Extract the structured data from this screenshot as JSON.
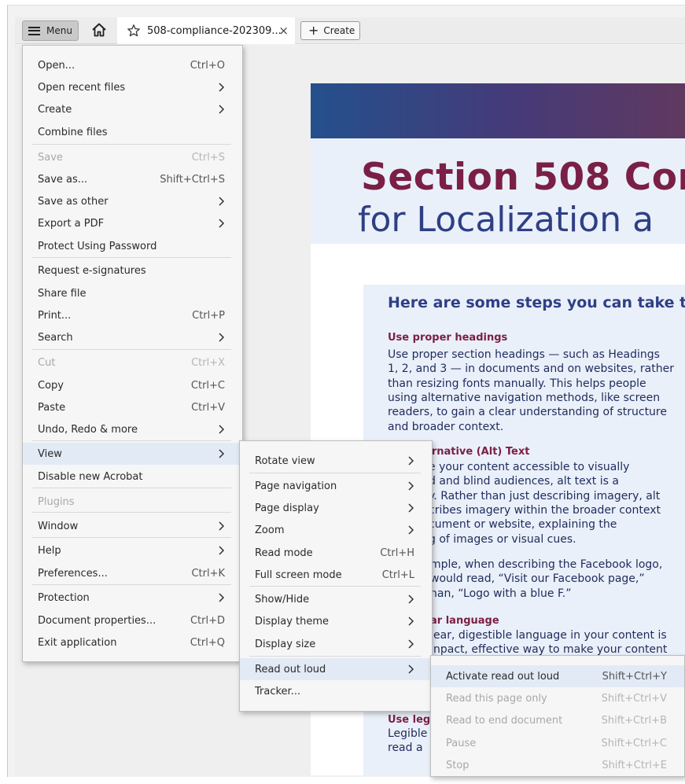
{
  "toolbar": {
    "menu_label": "Menu",
    "tab_title": "508-compliance-202309...",
    "tab_close": "×",
    "create_label": "Create"
  },
  "document": {
    "heading_line1": "Section 508 Cor",
    "heading_line2": "for Localization a",
    "box_title": "Here are some steps you can take t",
    "sections": [
      {
        "heading": "Use proper headings",
        "lines": [
          "Use proper section headings — such as Headings",
          "1, 2, and 3 — in documents and on websites, rather",
          "than resizing fonts manually. This helps people",
          "using alternative navigation methods, like screen",
          "readers, to gain a clear understanding of structure",
          "and broader context."
        ]
      },
      {
        "heading": "ernative (Alt) Text",
        "lines": [
          "e your content accessible to visually",
          "d and blind audiences, alt text is a",
          "y. Rather than just describing imagery, alt",
          "cribes imagery within the broader context",
          "cument or website, explaining the",
          "g of images or visual cues."
        ]
      },
      {
        "heading": "",
        "lines": [
          "mple, when describing the Facebook logo,",
          "would read, “Visit our Facebook page,”",
          "han, “Logo with a blue F.”"
        ]
      },
      {
        "heading": "ar language",
        "lines": [
          "ear, digestible language in your content is",
          "npact, effective way to make your content"
        ]
      },
      {
        "heading": "Use leg",
        "lines": [
          "Legible",
          "read a"
        ]
      }
    ]
  },
  "main_menu": [
    {
      "label": "Open...",
      "shortcut": "Ctrl+O"
    },
    {
      "label": "Open recent files",
      "submenu": true
    },
    {
      "label": "Create",
      "submenu": true
    },
    {
      "label": "Combine files"
    },
    {
      "label": "Save",
      "shortcut": "Ctrl+S",
      "disabled": true
    },
    {
      "label": "Save as...",
      "shortcut": "Shift+Ctrl+S"
    },
    {
      "label": "Save as other",
      "submenu": true
    },
    {
      "label": "Export a PDF",
      "submenu": true
    },
    {
      "label": "Protect Using Password"
    },
    {
      "label": "Request e-signatures"
    },
    {
      "label": "Share file"
    },
    {
      "label": "Print...",
      "shortcut": "Ctrl+P"
    },
    {
      "label": "Search",
      "submenu": true
    },
    {
      "label": "Cut",
      "shortcut": "Ctrl+X",
      "disabled": true
    },
    {
      "label": "Copy",
      "shortcut": "Ctrl+C"
    },
    {
      "label": "Paste",
      "shortcut": "Ctrl+V"
    },
    {
      "label": "Undo, Redo & more",
      "submenu": true
    },
    {
      "label": "View",
      "submenu": true,
      "highlighted": true
    },
    {
      "label": "Disable new Acrobat"
    },
    {
      "label": "Plugins",
      "disabled": true
    },
    {
      "label": "Window",
      "submenu": true
    },
    {
      "label": "Help",
      "submenu": true
    },
    {
      "label": "Preferences...",
      "shortcut": "Ctrl+K"
    },
    {
      "label": "Protection",
      "submenu": true
    },
    {
      "label": "Document properties...",
      "shortcut": "Ctrl+D"
    },
    {
      "label": "Exit application",
      "shortcut": "Ctrl+Q"
    }
  ],
  "view_menu": [
    {
      "label": "Rotate view",
      "submenu": true
    },
    {
      "label": "Page navigation",
      "submenu": true
    },
    {
      "label": "Page display",
      "submenu": true
    },
    {
      "label": "Zoom",
      "submenu": true
    },
    {
      "label": "Read mode",
      "shortcut": "Ctrl+H"
    },
    {
      "label": "Full screen mode",
      "shortcut": "Ctrl+L"
    },
    {
      "label": "Show/Hide",
      "submenu": true
    },
    {
      "label": "Display theme",
      "submenu": true
    },
    {
      "label": "Display size",
      "submenu": true
    },
    {
      "label": "Read out loud",
      "submenu": true,
      "highlighted": true
    },
    {
      "label": "Tracker..."
    }
  ],
  "read_menu": [
    {
      "label": "Activate read out loud",
      "shortcut": "Shift+Ctrl+Y",
      "highlighted": true
    },
    {
      "label": "Read this page only",
      "shortcut": "Shift+Ctrl+V",
      "disabled": true
    },
    {
      "label": "Read to end document",
      "shortcut": "Shift+Ctrl+B",
      "disabled": true
    },
    {
      "label": "Pause",
      "shortcut": "Shift+Ctrl+C",
      "disabled": true
    },
    {
      "label": "Stop",
      "shortcut": "Shift+Ctrl+E",
      "disabled": true
    }
  ],
  "colors": {
    "heading_accent": "#7a1f46",
    "heading_blue": "#2f3f86",
    "menu_highlight": "#e2eaf6"
  }
}
